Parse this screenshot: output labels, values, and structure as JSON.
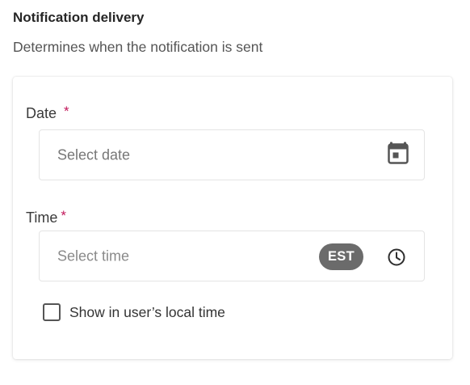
{
  "section": {
    "title": "Notification delivery",
    "description": "Determines when the notification is sent"
  },
  "date_field": {
    "label": "Date",
    "required_marker": "*",
    "placeholder": "Select date",
    "icon": "calendar-icon"
  },
  "time_field": {
    "label": "Time",
    "required_marker": "*",
    "placeholder": "Select time",
    "timezone_badge": "EST",
    "icon": "clock-icon"
  },
  "local_time_option": {
    "label": "Show in user’s local time",
    "checked": false
  },
  "colors": {
    "required": "#c2185b",
    "badge_bg": "#6b6b6b",
    "icon": "#555555"
  }
}
